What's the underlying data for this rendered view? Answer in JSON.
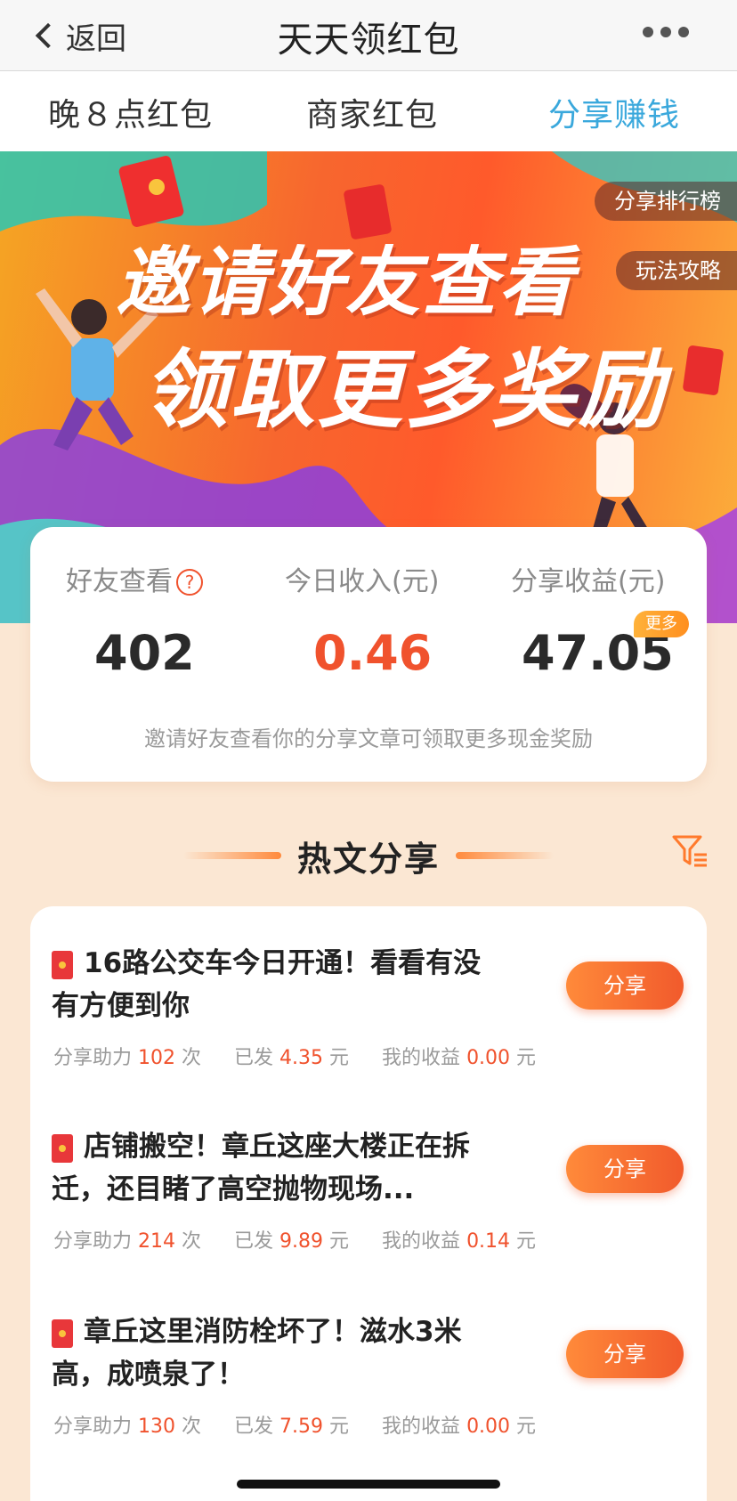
{
  "nav": {
    "back_label": "返回",
    "title": "天天领红包"
  },
  "tabs": [
    {
      "label": "晚８点红包",
      "active": false
    },
    {
      "label": "商家红包",
      "active": false
    },
    {
      "label": "分享赚钱",
      "active": true
    }
  ],
  "banner": {
    "line1": "邀请好友查看",
    "line2": "领取更多奖励",
    "ranking_label": "分享排行榜",
    "guide_label": "玩法攻略"
  },
  "stats": {
    "friends_label": "好友查看",
    "friends_value": "402",
    "today_label": "今日收入(元)",
    "today_value": "0.46",
    "earnings_label": "分享收益(元)",
    "earnings_value": "47.05",
    "more_badge": "更多",
    "hint": "邀请好友查看你的分享文章可领取更多现金奖励"
  },
  "hot": {
    "title": "热文分享"
  },
  "articles": [
    {
      "title": "16路公交车今日开通！看看有没有方便到你",
      "assist_label": "分享助力",
      "assist_count": "102",
      "assist_unit": "次",
      "sent_label": "已发",
      "sent_amount": "4.35",
      "sent_unit": "元",
      "earn_label": "我的收益",
      "earn_amount": "0.00",
      "earn_unit": "元",
      "button": "分享"
    },
    {
      "title": "店铺搬空！章丘这座大楼正在拆迁，还目睹了高空抛物现场...",
      "assist_label": "分享助力",
      "assist_count": "214",
      "assist_unit": "次",
      "sent_label": "已发",
      "sent_amount": "9.89",
      "sent_unit": "元",
      "earn_label": "我的收益",
      "earn_amount": "0.14",
      "earn_unit": "元",
      "button": "分享"
    },
    {
      "title": "章丘这里消防栓坏了！滋水3米高，成喷泉了！",
      "assist_label": "分享助力",
      "assist_count": "130",
      "assist_unit": "次",
      "sent_label": "已发",
      "sent_amount": "7.59",
      "sent_unit": "元",
      "earn_label": "我的收益",
      "earn_amount": "0.00",
      "earn_unit": "元",
      "button": "分享"
    }
  ],
  "colors": {
    "accent_blue": "#3aa8dc",
    "accent_red": "#f0522d",
    "page_bg": "#fbe7d3"
  }
}
